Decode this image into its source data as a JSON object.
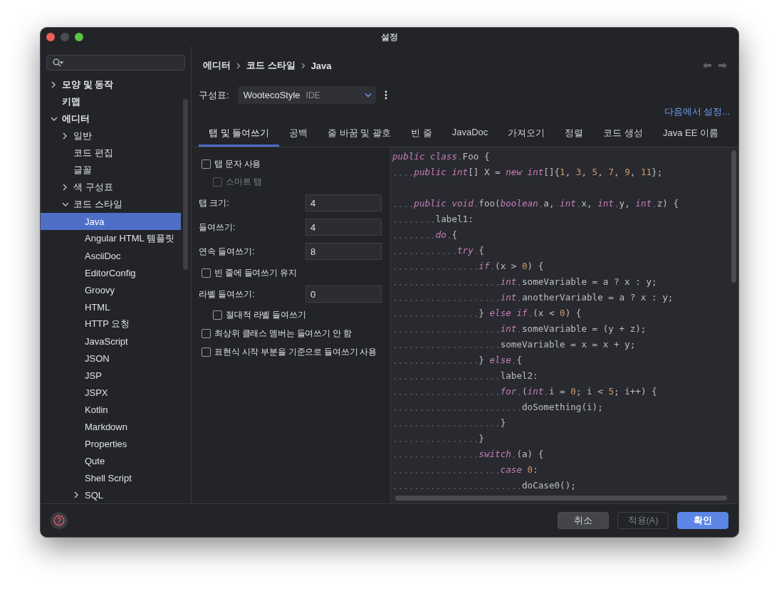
{
  "window": {
    "title": "설정"
  },
  "tree": [
    {
      "label": "모양 및 동작",
      "expanded": false,
      "selected": false
    },
    {
      "label": "키맵",
      "selected": false
    },
    {
      "label": "에디터",
      "expanded": true,
      "selected": false,
      "children": [
        {
          "label": "일반",
          "expanded": false,
          "selected": false
        },
        {
          "label": "코드 편집",
          "selected": false
        },
        {
          "label": "글꼴",
          "selected": false
        },
        {
          "label": "색 구성표",
          "expanded": false,
          "selected": false
        },
        {
          "label": "코드 스타일",
          "expanded": true,
          "selected": false,
          "children": [
            {
              "label": "Java",
              "selected": true
            },
            {
              "label": "Angular HTML 템플릿",
              "selected": false
            },
            {
              "label": "AsciiDoc",
              "selected": false
            },
            {
              "label": "EditorConfig",
              "selected": false
            },
            {
              "label": "Groovy",
              "selected": false
            },
            {
              "label": "HTML",
              "selected": false
            },
            {
              "label": "HTTP 요청",
              "selected": false
            },
            {
              "label": "JavaScript",
              "selected": false
            },
            {
              "label": "JSON",
              "selected": false
            },
            {
              "label": "JSP",
              "selected": false
            },
            {
              "label": "JSPX",
              "selected": false
            },
            {
              "label": "Kotlin",
              "selected": false
            },
            {
              "label": "Markdown",
              "selected": false
            },
            {
              "label": "Properties",
              "selected": false
            },
            {
              "label": "Qute",
              "selected": false
            },
            {
              "label": "Shell Script",
              "selected": false
            },
            {
              "label": "SQL",
              "expanded": false,
              "selected": false
            }
          ]
        }
      ]
    }
  ],
  "breadcrumb": [
    "에디터",
    "코드 스타일",
    "Java"
  ],
  "scheme": {
    "label": "구성표:",
    "value": "WootecoStyle",
    "tag": "IDE"
  },
  "link": "다음에서 설정...",
  "tabs": [
    {
      "label": "탭 및 들여쓰기",
      "selected": true
    },
    {
      "label": "공백",
      "selected": false
    },
    {
      "label": "줄 바꿈 및 괄호",
      "selected": false
    },
    {
      "label": "빈 줄",
      "selected": false
    },
    {
      "label": "JavaDoc",
      "selected": false
    },
    {
      "label": "가져오기",
      "selected": false
    },
    {
      "label": "정렬",
      "selected": false
    },
    {
      "label": "코드 생성",
      "selected": false
    },
    {
      "label": "Java EE 이름",
      "selected": false
    }
  ],
  "options": [
    {
      "kind": "checkbox",
      "label": "탭 문자 사용",
      "checked": false,
      "disabled": false,
      "children": [
        {
          "kind": "checkbox",
          "label": "스마트 탭",
          "checked": false,
          "disabled": true
        }
      ]
    },
    {
      "kind": "number",
      "label": "탭 크기:",
      "value": "4"
    },
    {
      "kind": "number",
      "label": "들여쓰기:",
      "value": "4"
    },
    {
      "kind": "number",
      "label": "연속 들여쓰기:",
      "value": "8"
    },
    {
      "kind": "checkbox",
      "label": "빈 줄에 들여쓰기 유지",
      "checked": false,
      "disabled": false
    },
    {
      "kind": "number",
      "label": "라벨 들여쓰기:",
      "value": "0",
      "children": [
        {
          "kind": "checkbox",
          "label": "절대적 라벨 들여쓰기",
          "checked": false,
          "disabled": false
        }
      ]
    },
    {
      "kind": "checkbox",
      "label": "최상위 클래스 멤버는 들여쓰기 안 함",
      "checked": false,
      "disabled": false
    },
    {
      "kind": "checkbox",
      "label": "표현식 시작 부분을 기준으로 들여쓰기 사용",
      "checked": false,
      "disabled": false
    }
  ],
  "code": [
    {
      "kind": "code",
      "tokens": [
        {
          "kind": "kw",
          "text": "public class"
        },
        {
          "kind": "p",
          "text": " Foo {"
        }
      ]
    },
    {
      "kind": "code",
      "tokens": [
        {
          "kind": "kw",
          "text": "    public int"
        },
        {
          "kind": "p",
          "text": "[] X = "
        },
        {
          "kind": "kw",
          "text": "new int"
        },
        {
          "kind": "p",
          "text": "[]{"
        },
        {
          "kind": "n",
          "text": "1"
        },
        {
          "kind": "p",
          "text": ", "
        },
        {
          "kind": "n",
          "text": "3"
        },
        {
          "kind": "p",
          "text": ", "
        },
        {
          "kind": "n",
          "text": "5"
        },
        {
          "kind": "p",
          "text": ", "
        },
        {
          "kind": "n",
          "text": "7"
        },
        {
          "kind": "p",
          "text": ", "
        },
        {
          "kind": "n",
          "text": "9"
        },
        {
          "kind": "p",
          "text": ", "
        },
        {
          "kind": "n",
          "text": "11"
        },
        {
          "kind": "p",
          "text": "};"
        }
      ]
    },
    {
      "kind": "blank"
    },
    {
      "kind": "code",
      "tokens": [
        {
          "kind": "kw",
          "text": "    public void"
        },
        {
          "kind": "p",
          "text": " foo("
        },
        {
          "kind": "kw",
          "text": "boolean"
        },
        {
          "kind": "p",
          "text": " a, "
        },
        {
          "kind": "kw",
          "text": "int"
        },
        {
          "kind": "p",
          "text": " x, "
        },
        {
          "kind": "kw",
          "text": "int"
        },
        {
          "kind": "p",
          "text": " y, "
        },
        {
          "kind": "kw",
          "text": "int"
        },
        {
          "kind": "p",
          "text": " z) {"
        }
      ]
    },
    {
      "kind": "code",
      "tokens": [
        {
          "kind": "p",
          "text": "        label1:"
        }
      ]
    },
    {
      "kind": "code",
      "tokens": [
        {
          "kind": "kw",
          "text": "        do"
        },
        {
          "kind": "p",
          "text": " {"
        }
      ]
    },
    {
      "kind": "code",
      "tokens": [
        {
          "kind": "kw",
          "text": "            try"
        },
        {
          "kind": "p",
          "text": " {"
        }
      ]
    },
    {
      "kind": "code",
      "tokens": [
        {
          "kind": "kw",
          "text": "                if"
        },
        {
          "kind": "p",
          "text": " (x > "
        },
        {
          "kind": "n",
          "text": "0"
        },
        {
          "kind": "p",
          "text": ") {"
        }
      ]
    },
    {
      "kind": "code",
      "tokens": [
        {
          "kind": "kw",
          "text": "                    int"
        },
        {
          "kind": "p",
          "text": " someVariable = a ? x : y;"
        }
      ]
    },
    {
      "kind": "code",
      "tokens": [
        {
          "kind": "kw",
          "text": "                    int"
        },
        {
          "kind": "p",
          "text": " anotherVariable = a ? x : y;"
        }
      ]
    },
    {
      "kind": "code",
      "tokens": [
        {
          "kind": "p",
          "text": "                } "
        },
        {
          "kind": "kw",
          "text": "else if"
        },
        {
          "kind": "p",
          "text": " (x < "
        },
        {
          "kind": "n",
          "text": "0"
        },
        {
          "kind": "p",
          "text": ") {"
        }
      ]
    },
    {
      "kind": "code",
      "tokens": [
        {
          "kind": "kw",
          "text": "                    int"
        },
        {
          "kind": "p",
          "text": " someVariable = (y + z);"
        }
      ]
    },
    {
      "kind": "code",
      "tokens": [
        {
          "kind": "p",
          "text": "                    someVariable = x = x + y;"
        }
      ]
    },
    {
      "kind": "code",
      "tokens": [
        {
          "kind": "p",
          "text": "                } "
        },
        {
          "kind": "kw",
          "text": "else"
        },
        {
          "kind": "p",
          "text": " {"
        }
      ]
    },
    {
      "kind": "code",
      "tokens": [
        {
          "kind": "p",
          "text": "                    label2:"
        }
      ]
    },
    {
      "kind": "code",
      "tokens": [
        {
          "kind": "kw",
          "text": "                    for"
        },
        {
          "kind": "p",
          "text": " ("
        },
        {
          "kind": "kw",
          "text": "int"
        },
        {
          "kind": "p",
          "text": " i = "
        },
        {
          "kind": "n",
          "text": "0"
        },
        {
          "kind": "p",
          "text": "; i < "
        },
        {
          "kind": "n",
          "text": "5"
        },
        {
          "kind": "p",
          "text": "; i++) {"
        }
      ]
    },
    {
      "kind": "code",
      "tokens": [
        {
          "kind": "p",
          "text": "                        doSomething(i);"
        }
      ]
    },
    {
      "kind": "code",
      "tokens": [
        {
          "kind": "p",
          "text": "                    }"
        }
      ]
    },
    {
      "kind": "code",
      "tokens": [
        {
          "kind": "p",
          "text": "                }"
        }
      ]
    },
    {
      "kind": "code",
      "tokens": [
        {
          "kind": "kw",
          "text": "                switch"
        },
        {
          "kind": "p",
          "text": " (a) {"
        }
      ]
    },
    {
      "kind": "code",
      "tokens": [
        {
          "kind": "kw",
          "text": "                    case "
        },
        {
          "kind": "n",
          "text": "0"
        },
        {
          "kind": "p",
          "text": ":"
        }
      ]
    },
    {
      "kind": "code",
      "tokens": [
        {
          "kind": "p",
          "text": "                        doCase0();"
        }
      ]
    }
  ],
  "buttons": [
    {
      "label": "취소",
      "kind": "normal",
      "disabled": false
    },
    {
      "label": "적용(A)",
      "kind": "normal",
      "disabled": true
    },
    {
      "label": "확인",
      "kind": "primary",
      "disabled": false
    }
  ]
}
